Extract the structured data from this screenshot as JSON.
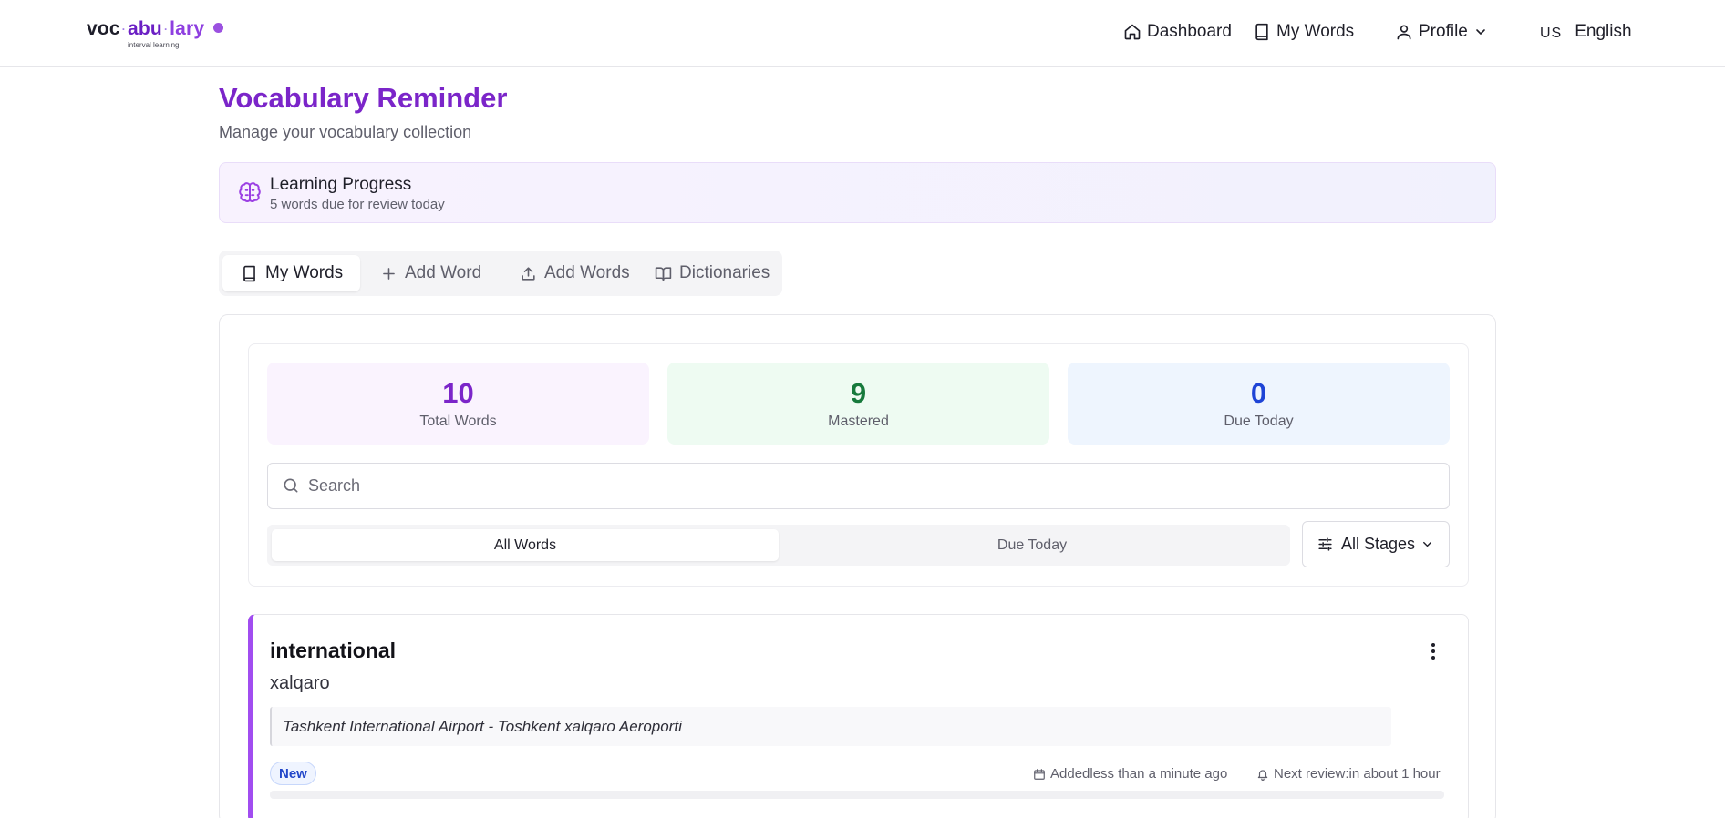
{
  "header": {
    "logo": {
      "part1": "voc",
      "part2": "abu",
      "part3": "lary",
      "tagline": "interval learning"
    },
    "nav": {
      "dashboard": "Dashboard",
      "my_words": "My Words",
      "profile": "Profile",
      "language_code": "US",
      "language": "English"
    }
  },
  "page": {
    "title": "Vocabulary Reminder",
    "subtitle": "Manage your vocabulary collection"
  },
  "progress": {
    "title": "Learning Progress",
    "subtitle": "5 words due for review today"
  },
  "tabs": [
    {
      "label": "My Words",
      "icon": "book-icon",
      "active": true
    },
    {
      "label": "Add Word",
      "icon": "plus-icon",
      "active": false
    },
    {
      "label": "Add Words",
      "icon": "upload-icon",
      "active": false
    },
    {
      "label": "Dictionaries",
      "icon": "open-book-icon",
      "active": false
    }
  ],
  "stats": {
    "total": {
      "value": "10",
      "label": "Total Words"
    },
    "mastered": {
      "value": "9",
      "label": "Mastered"
    },
    "due": {
      "value": "0",
      "label": "Due Today"
    }
  },
  "search": {
    "placeholder": "Search",
    "value": ""
  },
  "filters": {
    "all_words": "All Words",
    "due_today": "Due Today",
    "stage_select": "All Stages"
  },
  "words": [
    {
      "word": "international",
      "translation": "xalqaro",
      "example": "Tashkent International Airport - Toshkent xalqaro Aeroporti",
      "badge": "New",
      "added": "Addedless than a minute ago",
      "next_review": "Next review:in about 1 hour",
      "progress": 0
    }
  ],
  "colors": {
    "accent": "#7b25c9",
    "mastered": "#177a3c",
    "due": "#1e44d6",
    "word_border": "#a14df0"
  }
}
